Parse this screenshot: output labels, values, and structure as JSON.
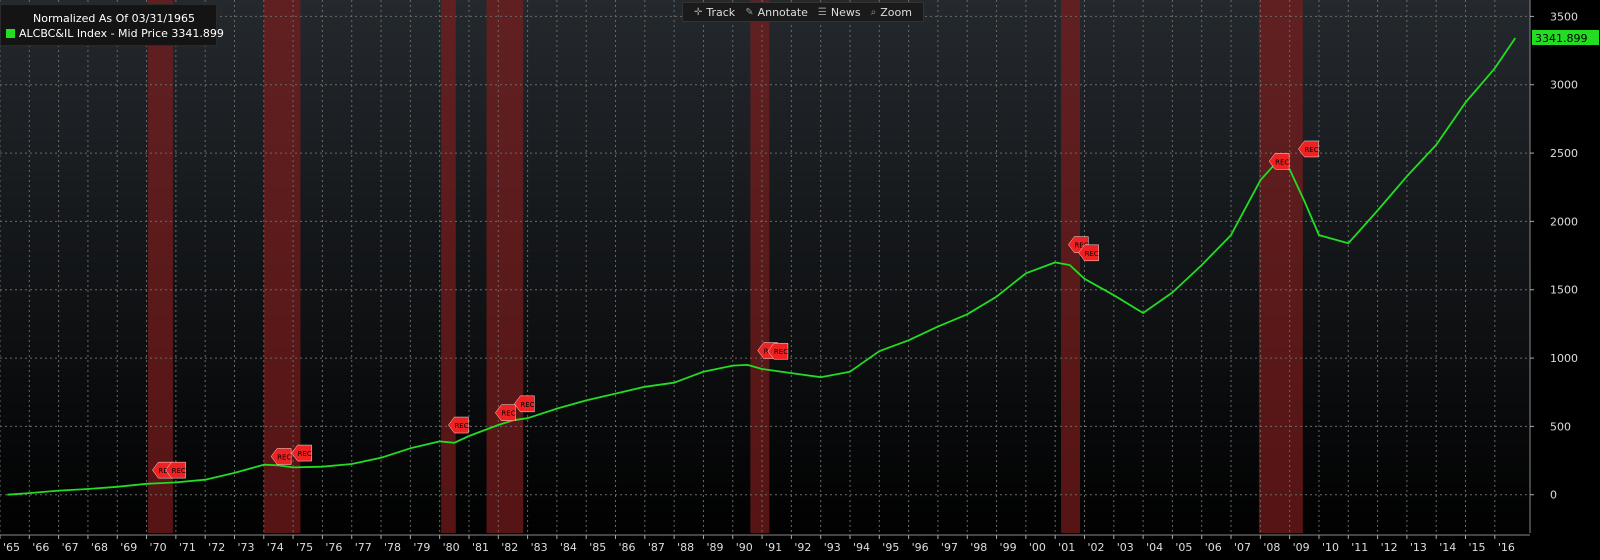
{
  "legend": {
    "title": "Normalized As Of 03/31/1965",
    "entry_label": "ALCBC&IL Index - Mid Price 3341.899",
    "swatch_color": "#22dd22"
  },
  "toolbar": {
    "buttons": [
      {
        "icon": "crosshair-icon",
        "glyph": "✛",
        "label": "Track"
      },
      {
        "icon": "pencil-icon",
        "glyph": "✎",
        "label": "Annotate"
      },
      {
        "icon": "news-icon",
        "glyph": "☰",
        "label": "News"
      },
      {
        "icon": "zoom-icon",
        "glyph": "⌕",
        "label": "Zoom"
      }
    ]
  },
  "chart_data": {
    "type": "line",
    "xlim": [
      1965.0,
      2017.2
    ],
    "ylim": [
      -280,
      3620
    ],
    "y_ticks": [
      0,
      500,
      1000,
      1500,
      2000,
      2500,
      3000,
      3500
    ],
    "x_tick_labels": [
      "'65",
      "'66",
      "'67",
      "'68",
      "'69",
      "'70",
      "'71",
      "'72",
      "'73",
      "'74",
      "'75",
      "'76",
      "'77",
      "'78",
      "'79",
      "'80",
      "'81",
      "'82",
      "'83",
      "'84",
      "'85",
      "'86",
      "'87",
      "'88",
      "'89",
      "'90",
      "'91",
      "'92",
      "'93",
      "'94",
      "'95",
      "'96",
      "'97",
      "'98",
      "'99",
      "'00",
      "'01",
      "'02",
      "'03",
      "'04",
      "'05",
      "'06",
      "'07",
      "'08",
      "'09",
      "'10",
      "'11",
      "'12",
      "'13",
      "'14",
      "'15",
      "'16"
    ],
    "grid": true,
    "colors": {
      "line": "#22dd22",
      "grid": "#6a6a6a",
      "recession": "#7a1c1c",
      "marker": "#ee2222",
      "last_value_bg": "#22dd22"
    },
    "last_value_label": "3341.899",
    "marker_label": "REC",
    "series": [
      {
        "x": [
          1965.25,
          1966,
          1967,
          1968,
          1969,
          1970,
          1970.5,
          1971,
          1972,
          1973,
          1974,
          1974.5,
          1975,
          1976,
          1977,
          1978,
          1979,
          1980,
          1980.5,
          1981,
          1982,
          1982.5,
          1983,
          1984,
          1985,
          1986,
          1987,
          1988,
          1989,
          1990,
          1990.5,
          1991,
          1992,
          1993,
          1994,
          1995,
          1996,
          1997,
          1998,
          1999,
          2000,
          2001,
          2001.5,
          2002,
          2003,
          2004,
          2005,
          2006,
          2007,
          2008,
          2008.5,
          2009,
          2009.5,
          2010,
          2011,
          2012,
          2013,
          2014,
          2015,
          2016,
          2016.7
        ],
        "y": [
          0,
          12,
          30,
          42,
          58,
          80,
          85,
          90,
          110,
          160,
          220,
          215,
          200,
          205,
          225,
          270,
          340,
          390,
          380,
          430,
          510,
          545,
          560,
          630,
          690,
          740,
          790,
          820,
          900,
          945,
          950,
          920,
          890,
          860,
          900,
          1050,
          1130,
          1230,
          1320,
          1450,
          1620,
          1700,
          1680,
          1580,
          1460,
          1330,
          1480,
          1680,
          1900,
          2300,
          2420,
          2380,
          2150,
          1900,
          1840,
          2080,
          2330,
          2560,
          2870,
          3120,
          3342
        ]
      }
    ],
    "recessions": [
      [
        1970.05,
        1970.9
      ],
      [
        1974.0,
        1975.25
      ],
      [
        1980.05,
        1980.55
      ],
      [
        1981.6,
        1982.85
      ],
      [
        1990.6,
        1991.25
      ],
      [
        2001.2,
        2001.85
      ],
      [
        2007.95,
        2009.45
      ]
    ],
    "markers": [
      [
        1970.2,
        180
      ],
      [
        1970.65,
        180
      ],
      [
        1974.25,
        280
      ],
      [
        1974.95,
        305
      ],
      [
        1980.3,
        510
      ],
      [
        1981.9,
        600
      ],
      [
        1982.55,
        665
      ],
      [
        1990.85,
        1055
      ],
      [
        1991.2,
        1050
      ],
      [
        2001.45,
        1830
      ],
      [
        2001.8,
        1770
      ],
      [
        2008.3,
        2440
      ],
      [
        2009.3,
        2530
      ]
    ]
  }
}
